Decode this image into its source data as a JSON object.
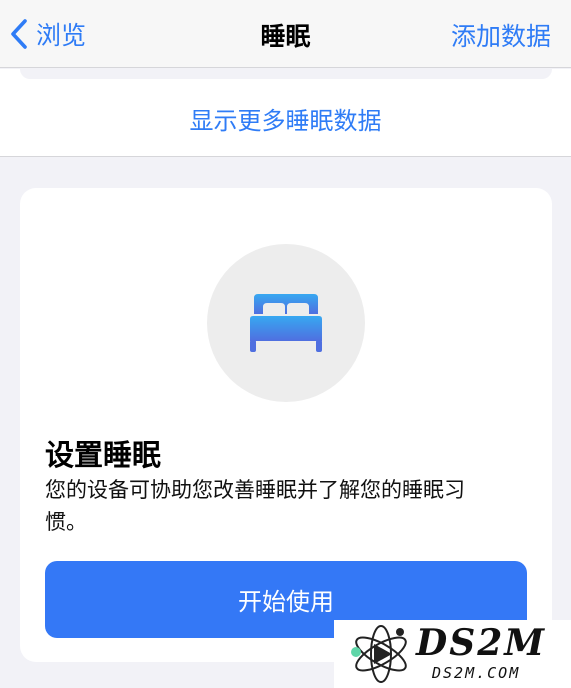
{
  "nav": {
    "back_label": "浏览",
    "title": "睡眠",
    "add_label": "添加数据"
  },
  "more_link": "显示更多睡眠数据",
  "setup_card": {
    "icon": "bed-icon",
    "title": "设置睡眠",
    "description": "您的设备可协助您改善睡眠并了解您的睡眠习惯。",
    "button_label": "开始使用"
  },
  "watermark": {
    "brand": "DS2M",
    "site": "DS2M.COM"
  },
  "colors": {
    "accent": "#2f7cf6",
    "button": "#3478f6",
    "background": "#f2f2f7",
    "icon_gradient_top": "#37a8f1",
    "icon_gradient_bottom": "#4f6fe0"
  }
}
